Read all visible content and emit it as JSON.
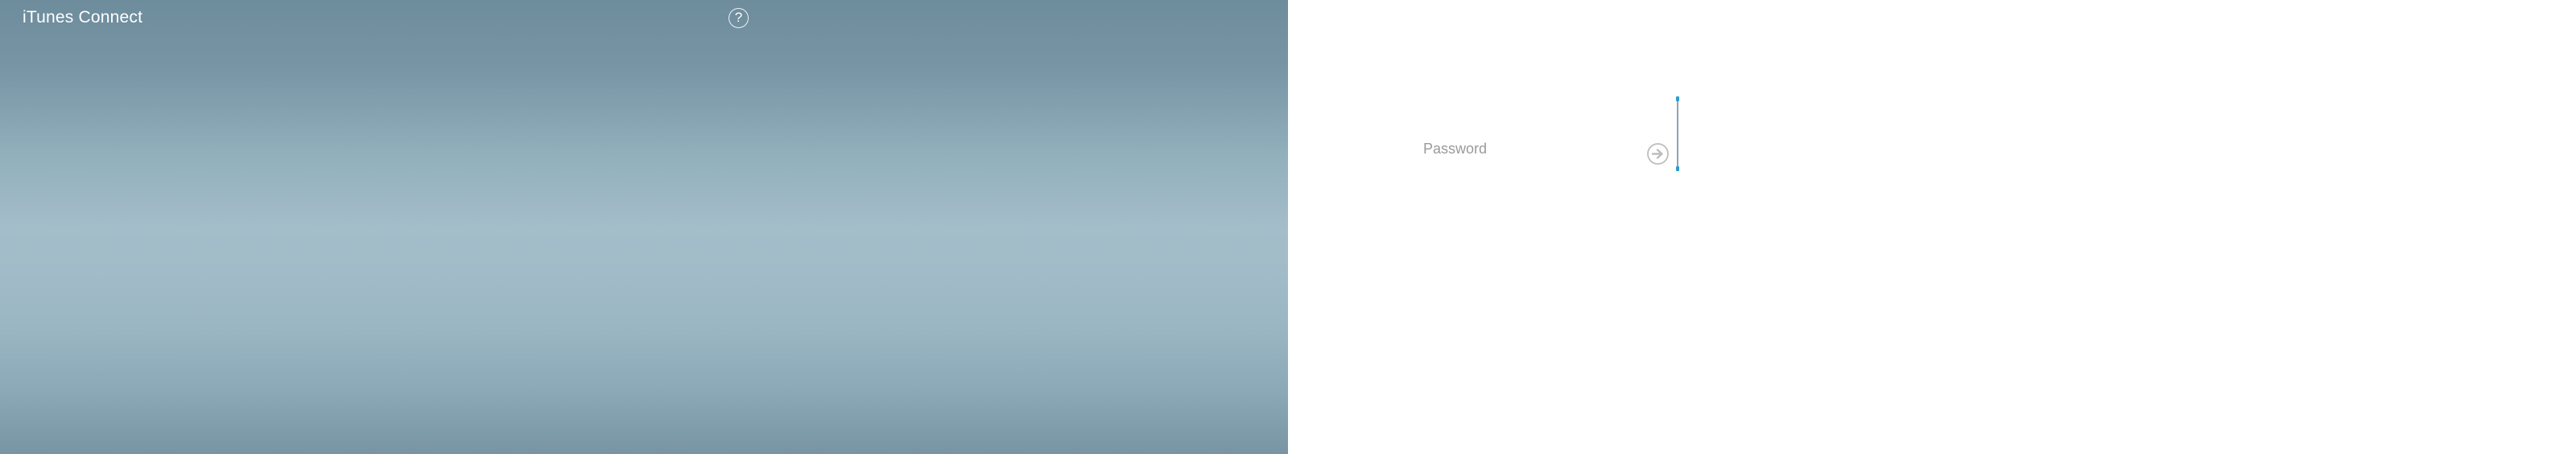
{
  "header": {
    "app_title": "iTunes Connect",
    "help_icon": "help-icon",
    "help_glyph": "?"
  },
  "login": {
    "password_placeholder": "Password",
    "password_value": "",
    "submit_icon": "arrow-right-circle-icon"
  },
  "colors": {
    "left_panel_top": "#6d8c9c",
    "left_panel_mid": "#a3bdc9",
    "left_panel_bottom": "#7995a4",
    "right_panel": "#ffffff",
    "accent": "#2a9cd3"
  }
}
